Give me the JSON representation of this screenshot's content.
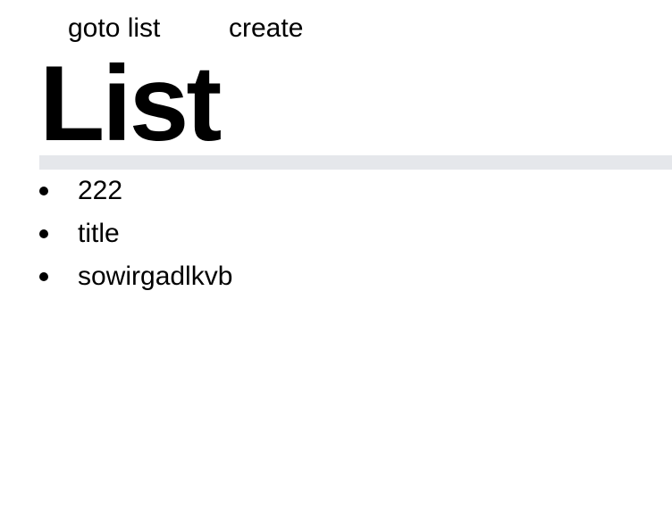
{
  "nav": {
    "links": [
      {
        "label": "goto list"
      },
      {
        "label": "create"
      }
    ]
  },
  "page": {
    "title": "List"
  },
  "list": {
    "items": [
      {
        "label": "222"
      },
      {
        "label": "title"
      },
      {
        "label": "sowirgadlkvb"
      }
    ]
  }
}
